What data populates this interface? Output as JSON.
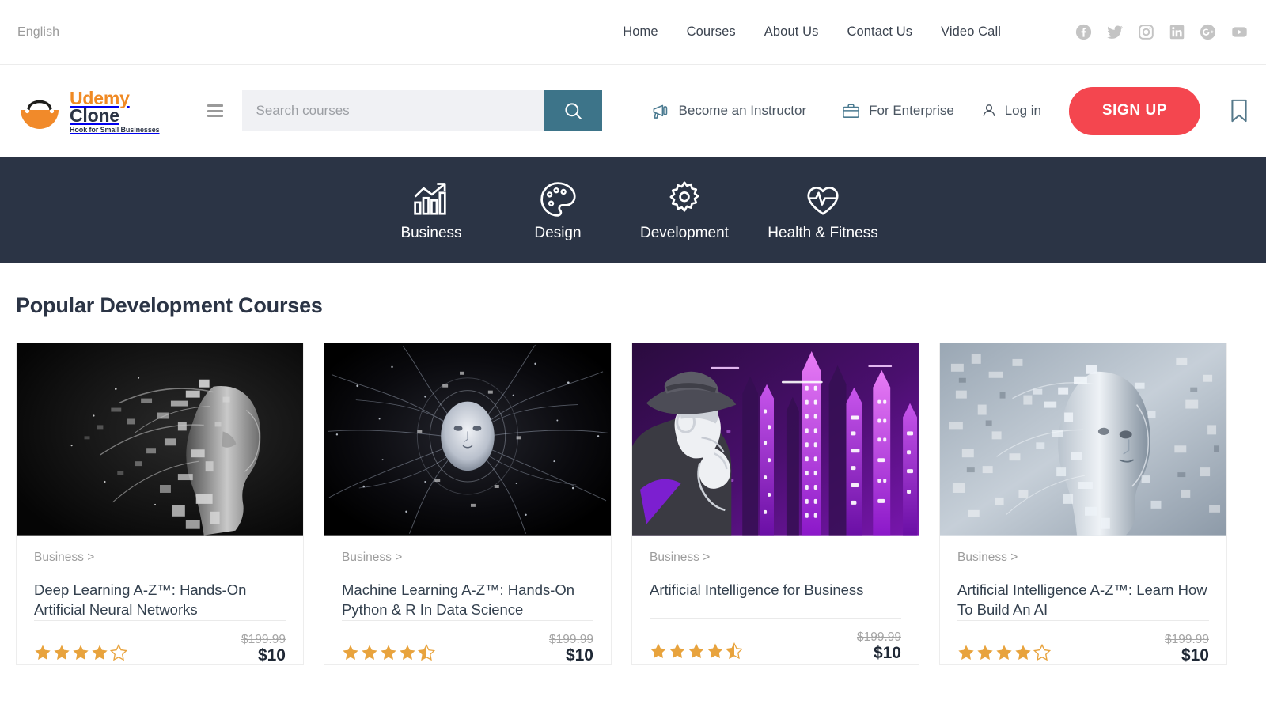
{
  "topbar": {
    "language": "English",
    "nav": [
      {
        "label": "Home",
        "name": "home"
      },
      {
        "label": "Courses",
        "name": "courses"
      },
      {
        "label": "About Us",
        "name": "about-us"
      },
      {
        "label": "Contact Us",
        "name": "contact-us"
      },
      {
        "label": "Video Call",
        "name": "video-call"
      }
    ],
    "socials": [
      {
        "icon": "facebook-icon"
      },
      {
        "icon": "twitter-icon"
      },
      {
        "icon": "instagram-icon"
      },
      {
        "icon": "linkedin-icon"
      },
      {
        "icon": "google-plus-icon"
      },
      {
        "icon": "youtube-icon"
      }
    ]
  },
  "header": {
    "logo": {
      "line1": "Udemy",
      "line2": "Clone",
      "tagline": "Hook for Small Businesses",
      "mark_color": "#f18a2a",
      "word_color": "#f08a24",
      "dark_color": "#2b3445"
    },
    "search": {
      "placeholder": "Search courses",
      "value": "",
      "button_color": "#3d7489",
      "field_bg": "#f0f1f4"
    },
    "links": [
      {
        "label": "Become an Instructor",
        "icon": "megaphone-icon"
      },
      {
        "label": "For Enterprise",
        "icon": "briefcase-icon"
      }
    ],
    "login_label": "Log in",
    "signup_label": "SIGN UP",
    "signup_color": "#f4464f",
    "bookmark_icon": "bookmark-icon"
  },
  "categories": {
    "bar_color": "#2b3445",
    "items": [
      {
        "label": "Business",
        "icon": "bar-chart-growth-icon"
      },
      {
        "label": "Design",
        "icon": "paint-palette-icon"
      },
      {
        "label": "Development",
        "icon": "gear-icon"
      },
      {
        "label": "Health & Fitness",
        "icon": "heart-pulse-icon"
      }
    ]
  },
  "section": {
    "title": "Popular Development Courses"
  },
  "courses": [
    {
      "category": "Business >",
      "title": "Deep Learning A-Z™: Hands-On Artificial Neural Networks",
      "rating": 4,
      "price_old": "$199.99",
      "price_new": "$10",
      "thumb": "dark-shattered-head-profile"
    },
    {
      "category": "Business >",
      "title": "Machine Learning A-Z™: Hands-On Python & R In Data Science",
      "rating": 4.5,
      "price_old": "$199.99",
      "price_new": "$10",
      "thumb": "particle-face-network"
    },
    {
      "category": "Business >",
      "title": "Artificial Intelligence for Business",
      "rating": 4.5,
      "price_old": "$199.99",
      "price_new": "$10",
      "thumb": "purple-noir-detective-city"
    },
    {
      "category": "Business >",
      "title": "Artificial Intelligence A-Z™: Learn How To Build An AI",
      "rating": 4,
      "price_old": "$199.99",
      "price_new": "$10",
      "thumb": "silver-fragmented-robot-head"
    }
  ],
  "colors": {
    "star_filled": "#e8a33d",
    "star_empty": "#e8a33d",
    "dark_navy": "#2b3445",
    "accent_red": "#f4464f",
    "teal": "#3d7489"
  }
}
